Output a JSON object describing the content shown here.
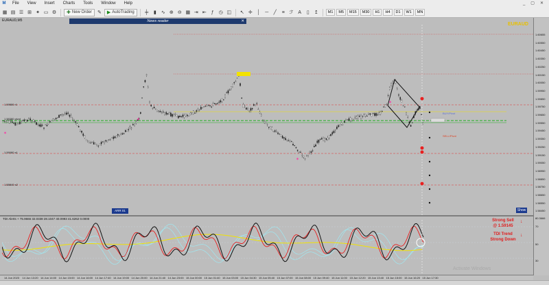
{
  "menu": {
    "logo": "M",
    "items": [
      "File",
      "View",
      "Insert",
      "Charts",
      "Tools",
      "Window",
      "Help"
    ],
    "window_controls": [
      "_",
      "▢",
      "✕"
    ]
  },
  "toolbar": {
    "new_order": "New Order",
    "autotrading": "AutoTrading",
    "timeframes": [
      "M1",
      "M5",
      "M15",
      "M30",
      "H1",
      "H4",
      "D1",
      "W1",
      "MN"
    ]
  },
  "chart": {
    "title": "EURAUD,M5",
    "symbol_label": "EURAUD",
    "news_reader": "News reader",
    "news_close": "✕",
    "show_button": "Show",
    "badge": "ARR 01",
    "left_levels": [
      "1.59580 r1",
      "1.59280 pivot",
      "1.59080 s1",
      "1.58840 s2"
    ],
    "buy_pivot": "BUY/Pivot",
    "sell_pivot": "SELL/Pivot",
    "price_ticks": [
      "1.60655",
      "1.60550",
      "1.60450",
      "1.60350",
      "1.60250",
      "1.60150",
      "1.60050",
      "1.59950",
      "1.59850",
      "1.59750",
      "1.59650",
      "1.59550",
      "1.59450",
      "1.59350",
      "1.59250",
      "1.59150",
      "1.59050",
      "1.58950",
      "1.58850",
      "1.58750",
      "1.58650",
      "1.58550",
      "1.58450"
    ],
    "colors": {
      "up_line": "#e03030",
      "pivot": "#20b020",
      "yellow": "#f2e200",
      "mark": "#ff2aa0"
    }
  },
  "tdi": {
    "title": "TDI Alerts + 75.9666 32.0338 28.1047 40.0993 41.6262 0.0000",
    "ticks": [
      "80.3666",
      "70",
      "50",
      "30"
    ],
    "signal_line1": "Strong Sell",
    "signal_line2": "@ 1.59145",
    "trend_line1": "TDI Trend",
    "trend_line2": "Strong Down",
    "arrow": "↓"
  },
  "time_axis": [
    "14 Jun 2023",
    "14 Jun 13:20",
    "14 Jun 14:00",
    "14 Jun 15:00",
    "14 Jun 16:00",
    "14 Jun 17:40",
    "14 Jun 19:00",
    "14 Jun 20:00",
    "14 Jun 21:40",
    "14 Jun 23:00",
    "15 Jun 00:00",
    "15 Jun 01:40",
    "15 Jun 03:00",
    "15 Jun 04:30",
    "15 Jun 05:40",
    "15 Jun 07:00",
    "15 Jun 08:00",
    "15 Jun 09:40",
    "15 Jun 11:00",
    "15 Jun 12:20",
    "15 Jun 13:40",
    "15 Jun 15:00",
    "15 Jun 16:20",
    "15 Jun 17:30"
  ],
  "watermark": "Activate Windows"
}
